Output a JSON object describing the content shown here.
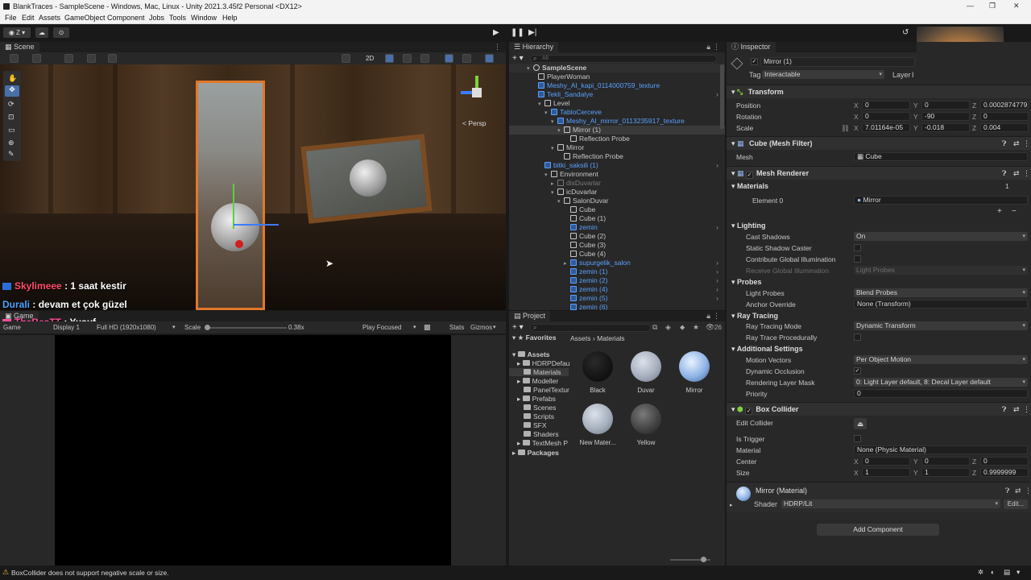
{
  "title_bar": {
    "title": "BlankTraces - SampleScene - Windows, Mac, Linux - Unity 2021.3.45f2 Personal <DX12>"
  },
  "menu": [
    "File",
    "Edit",
    "Assets",
    "GameObject",
    "Component",
    "Jobs",
    "Tools",
    "Window",
    "Help"
  ],
  "toolbar": {
    "account_label": "Z"
  },
  "scene": {
    "tab": "Scene",
    "toolbar": {
      "mode_2d": "2D"
    },
    "persp_label": "< Persp"
  },
  "chat": [
    {
      "user": "Skylimeee",
      "message": ": 1 saat kestir",
      "user_color": "#ff4d6a"
    },
    {
      "user": "Durali",
      "message": ": devam et çok güzel",
      "user_color": "#4da3ff"
    },
    {
      "user": "TheBesTT",
      "message": ": Yusuf",
      "user_color": "#ff4d9a"
    }
  ],
  "game": {
    "tab": "Game",
    "game_label": "Game",
    "display": "Display 1",
    "resolution": "Full HD (1920x1080)",
    "scale_label": "Scale",
    "scale_value": "0.38x",
    "play_mode": "Play Focused",
    "stats": "Stats",
    "gizmos": "Gizmos"
  },
  "hierarchy": {
    "tab": "Hierarchy",
    "search_placeholder": "All",
    "rows": [
      {
        "label": "SampleScene",
        "style": "scene"
      },
      {
        "label": "PlayerWoman",
        "style": "normal"
      },
      {
        "label": "Meshy_AI_kapi_0114000759_texture",
        "style": "blue"
      },
      {
        "label": "Tekli_Sandalye",
        "style": "blue"
      },
      {
        "label": "Level",
        "style": "normal"
      },
      {
        "label": "TabloCerceve",
        "style": "blue"
      },
      {
        "label": "Meshy_AI_mirror_0113235917_texture",
        "style": "blue"
      },
      {
        "label": "Mirror (1)",
        "style": "selected"
      },
      {
        "label": "Reflection Probe",
        "style": "normal"
      },
      {
        "label": "Mirror",
        "style": "normal"
      },
      {
        "label": "Reflection Probe",
        "style": "normal"
      },
      {
        "label": "bitki_saksili (1)",
        "style": "blue"
      },
      {
        "label": "Environment",
        "style": "normal"
      },
      {
        "label": "disDuvarlar",
        "style": "dim"
      },
      {
        "label": "icDuvarlar",
        "style": "normal"
      },
      {
        "label": "SalonDuvar",
        "style": "normal"
      },
      {
        "label": "Cube",
        "style": "normal"
      },
      {
        "label": "Cube (1)",
        "style": "normal"
      },
      {
        "label": "zemin",
        "style": "blue"
      },
      {
        "label": "Cube (2)",
        "style": "normal"
      },
      {
        "label": "Cube (3)",
        "style": "normal"
      },
      {
        "label": "Cube (4)",
        "style": "normal"
      },
      {
        "label": "supurgelik_salon",
        "style": "blue"
      },
      {
        "label": "zemin (1)",
        "style": "blue"
      },
      {
        "label": "zemin (2)",
        "style": "blue"
      },
      {
        "label": "zemin (4)",
        "style": "blue"
      },
      {
        "label": "zemin (5)",
        "style": "blue"
      },
      {
        "label": "zemin (6)",
        "style": "blue"
      }
    ]
  },
  "project": {
    "tab": "Project",
    "count": "26",
    "favorites": "Favorites",
    "assets_root": "Assets",
    "folders": [
      "HDRPDefau",
      "Materials",
      "Modeller",
      "PanelTextur",
      "Prefabs",
      "Scenes",
      "Scripts",
      "SFX",
      "Shaders",
      "TextMesh P"
    ],
    "packages": "Packages",
    "breadcrumb": [
      "Assets",
      "Materials"
    ],
    "assets": [
      {
        "name": "Black",
        "color": "#0d0d0d"
      },
      {
        "name": "Duvar",
        "color": "#a6afbd"
      },
      {
        "name": "Mirror",
        "color": "#8fb4e6"
      },
      {
        "name": "New Mater...",
        "color": "#a6afbd"
      },
      {
        "name": "Yellow",
        "color": "#444444"
      }
    ]
  },
  "inspector": {
    "tab": "Inspector",
    "object_name": "Mirror (1)",
    "tag_label": "Tag",
    "tag": "Interactable",
    "layer_label": "Layer",
    "layer_value": "I",
    "transform": {
      "title": "Transform",
      "position": {
        "label": "Position",
        "x": "0",
        "y": "0",
        "z": "0.0002874779"
      },
      "rotation": {
        "label": "Rotation",
        "x": "0",
        "y": "-90",
        "z": "0"
      },
      "scale": {
        "label": "Scale",
        "x": "7.01164e-05",
        "y": "-0.018",
        "z": "0.004"
      }
    },
    "mesh_filter": {
      "title": "Cube (Mesh Filter)",
      "mesh_label": "Mesh",
      "mesh": "Cube"
    },
    "mesh_renderer": {
      "title": "Mesh Renderer",
      "materials_label": "Materials",
      "materials_count": "1",
      "element0_label": "Element 0",
      "element0": "Mirror",
      "lighting": "Lighting",
      "cast_shadows_label": "Cast Shadows",
      "cast_shadows": "On",
      "static_shadow_caster": "Static Shadow Caster",
      "contribute_gi": "Contribute Global Illumination",
      "receive_gi_label": "Receive Global Illumination",
      "receive_gi": "Light Probes",
      "probes": "Probes",
      "light_probes_label": "Light Probes",
      "light_probes": "Blend Probes",
      "anchor_override_label": "Anchor Override",
      "anchor_override": "None (Transform)",
      "ray_tracing": "Ray Tracing",
      "ray_tracing_mode_label": "Ray Tracing Mode",
      "ray_tracing_mode": "Dynamic Transform",
      "ray_trace_procedurally": "Ray Trace Procedurally",
      "additional_settings": "Additional Settings",
      "motion_vectors_label": "Motion Vectors",
      "motion_vectors": "Per Object Motion",
      "dynamic_occlusion": "Dynamic Occlusion",
      "rendering_layer_mask_label": "Rendering Layer Mask",
      "rendering_layer_mask": "0: Light Layer default, 8: Decal Layer default",
      "priority_label": "Priority",
      "priority": "0"
    },
    "box_collider": {
      "title": "Box Collider",
      "edit_collider": "Edit Collider",
      "is_trigger": "Is Trigger",
      "material_label": "Material",
      "material": "None (Physic Material)",
      "center": {
        "label": "Center",
        "x": "0",
        "y": "0",
        "z": "0"
      },
      "size": {
        "label": "Size",
        "x": "1",
        "y": "1",
        "z": "0.9999999"
      }
    },
    "material": {
      "title": "Mirror (Material)",
      "shader_label": "Shader",
      "shader": "HDRP/Lit",
      "edit": "Edit..."
    },
    "add_component": "Add Component"
  },
  "status": {
    "message": "BoxCollider does not support negative scale or size."
  }
}
